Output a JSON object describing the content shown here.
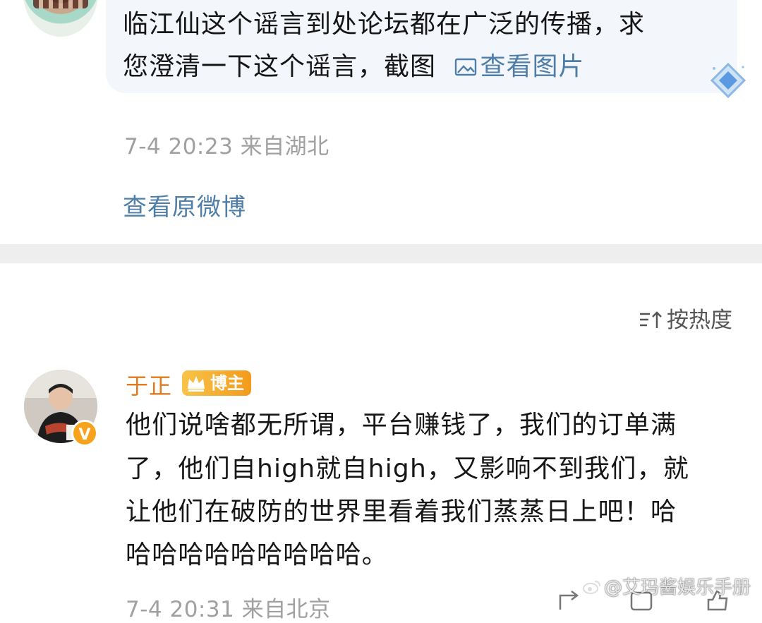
{
  "post": {
    "line1": "临江仙这个谣言到处论坛都在广泛的传播，求",
    "line2_prefix": "您澄清一下这个谣言，截图",
    "view_image": "查看图片",
    "meta": "7-4 20:23 来自湖北",
    "view_original": "查看原微博"
  },
  "sort": {
    "label": "按热度",
    "icon": "sort-icon"
  },
  "comment": {
    "username": "于正",
    "badge": "博主",
    "verified_badge": "V",
    "lines": [
      "他们说啥都无所谓，平台赚钱了，我们的订单满",
      "了，他们自high就自high，又影响不到我们，就",
      "让他们在破防的世界里看着我们蒸蒸日上吧！哈",
      "哈哈哈哈哈哈哈哈哈。"
    ],
    "meta": "7-4 20:31 来自北京"
  },
  "watermark": "@艾玛酱娱乐手册",
  "colors": {
    "link": "#4f7fa8",
    "username": "#e07a1f",
    "meta": "#a0a0a0",
    "divider": "#eeeeee"
  }
}
